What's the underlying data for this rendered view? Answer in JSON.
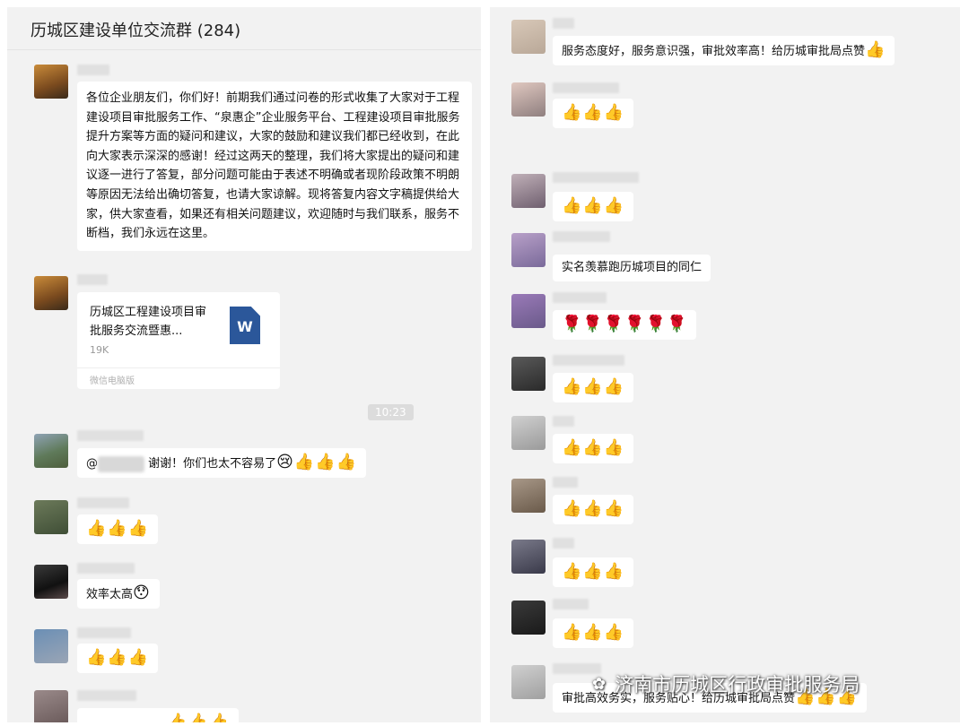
{
  "header": {
    "title": "历城区建设单位交流群 (284)"
  },
  "left_messages": {
    "announcement": "各位企业朋友们，你们好！前期我们通过问卷的形式收集了大家对于工程建设项目审批服务工作、“泉惠企”企业服务平台、工程建设项目审批服务提升方案等方面的疑问和建议，大家的鼓励和建议我们都已经收到，在此向大家表示深深的感谢！经过这两天的整理，我们将大家提出的疑问和建议逐一进行了答复，部分问题可能由于表述不明确或者现阶段政策不明朗等原因无法给出确切答复，也请大家谅解。现将答复内容文字稿提供给大家，供大家查看，如果还有相关问题建议，欢迎随时与我们联系，服务不断档，我们永远在这里。",
    "file": {
      "title": "历城区工程建设项目审批服务交流暨惠...",
      "size": "19K",
      "source": "微信电脑版",
      "icon_letter": "W"
    },
    "timestamp": "10:23",
    "reply_prefix": "@",
    "reply_text": "谢谢！你们也太不容易了",
    "reply_emoji": "😢👍👍👍",
    "thumbs": "👍👍👍",
    "efficiency": "效率太高",
    "efficiency_emoji": "😯",
    "thumbs2": "👍👍👍",
    "partial": "👍👍👍"
  },
  "right_messages": {
    "praise": "服务态度好，服务意识强，审批效率高！给历城审批局点赞",
    "praise_emoji": "👍",
    "thumbs_a": "👍👍👍",
    "thumbs_b": "👍👍👍",
    "admire": "实名羡慕跑历城项目的同仁",
    "roses": "🌹🌹🌹🌹🌹🌹",
    "thumbs_c": "👍👍👍",
    "thumbs_d": "👍👍👍",
    "thumbs_e": "👍👍👍",
    "thumbs_f": "👍👍👍",
    "thumbs_g": "👍👍👍",
    "last": "审批高效务实，服务贴心！给历城审批局点赞",
    "last_emoji": "👍👍👍"
  },
  "watermark": {
    "text": "济南市历城区行政审批服务局",
    "icon": "wechat-icon"
  }
}
